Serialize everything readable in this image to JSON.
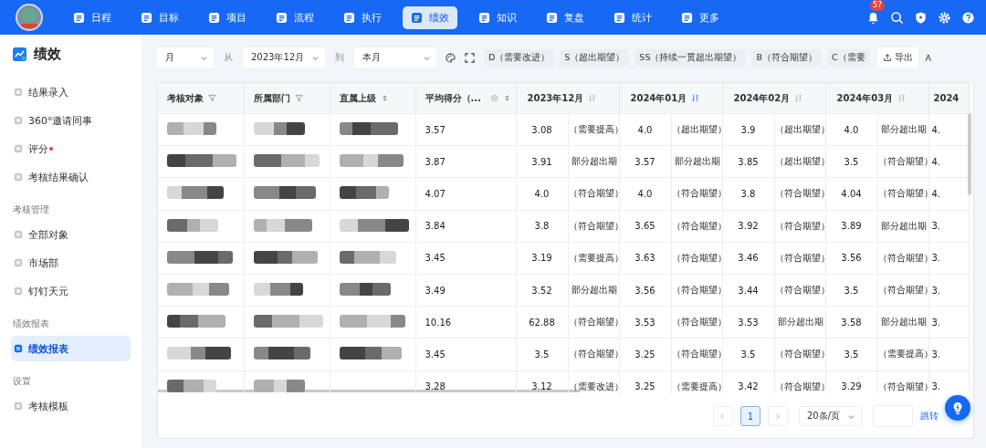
{
  "top_nav": {
    "items": [
      {
        "label": "日程",
        "selected": false
      },
      {
        "label": "目标",
        "selected": false
      },
      {
        "label": "项目",
        "selected": false
      },
      {
        "label": "流程",
        "selected": false
      },
      {
        "label": "执行",
        "selected": false
      },
      {
        "label": "绩效",
        "selected": true
      },
      {
        "label": "知识",
        "selected": false
      },
      {
        "label": "复盘",
        "selected": false
      },
      {
        "label": "统计",
        "selected": false
      },
      {
        "label": "更多",
        "selected": false
      }
    ],
    "notifications": "57"
  },
  "sidebar": {
    "title": "绩效",
    "sections": [
      {
        "items": [
          {
            "label": "结果录入",
            "selected": false,
            "dot": false
          },
          {
            "label": "360°邀请同事",
            "selected": false,
            "dot": false
          },
          {
            "label": "评分",
            "selected": false,
            "dot": true
          },
          {
            "label": "考核结果确认",
            "selected": false,
            "dot": false
          }
        ]
      },
      {
        "heading": "考核管理",
        "items": [
          {
            "label": "全部对象",
            "selected": false,
            "dot": false
          },
          {
            "label": "市场部",
            "selected": false,
            "dot": false
          },
          {
            "label": "钉钉天元",
            "selected": false,
            "dot": false
          }
        ]
      },
      {
        "heading": "绩效报表",
        "items": [
          {
            "label": "绩效报表",
            "selected": true,
            "dot": false
          }
        ]
      },
      {
        "heading": "设置",
        "items": [
          {
            "label": "考核模板",
            "selected": false,
            "dot": false
          }
        ]
      }
    ]
  },
  "toolbar": {
    "period": "月",
    "from_label": "从",
    "from": "2023年12月",
    "to_label": "到",
    "to": "本月",
    "grade_tags": [
      "D（需要改进）",
      "S（超出期望）",
      "SS（持续一贯超出期望）",
      "B（符合期望）",
      "C（需要"
    ],
    "export": "导出",
    "last_tag": "A"
  },
  "table": {
    "columns": [
      {
        "label": "考核对象",
        "kind": "filter"
      },
      {
        "label": "所属部门",
        "kind": "filter"
      },
      {
        "label": "直属上级",
        "kind": "sort"
      },
      {
        "label": "平均得分（...",
        "kind": "setting"
      }
    ],
    "months": [
      {
        "label": "2023年12月",
        "sorted": false
      },
      {
        "label": "2024年01月",
        "sorted": true
      },
      {
        "label": "2024年02月",
        "sorted": false
      },
      {
        "label": "2024年03月",
        "sorted": false
      }
    ],
    "last_column": "2024",
    "rows": [
      {
        "masked": [
          true,
          true,
          true
        ],
        "average": "3.57",
        "months": [
          {
            "score": "3.08",
            "grade": "（需要提高）"
          },
          {
            "score": "4.0",
            "grade": "（超出期望）"
          },
          {
            "score": "3.9",
            "grade": "（超出期望）"
          },
          {
            "score": "4.0",
            "grade": "部分超出期"
          }
        ],
        "last": "4."
      },
      {
        "masked": [
          true,
          true,
          true
        ],
        "average": "3.87",
        "months": [
          {
            "score": "3.91",
            "grade": "部分超出期"
          },
          {
            "score": "3.57",
            "grade": "部分超出期"
          },
          {
            "score": "3.85",
            "grade": "（超出期望）"
          },
          {
            "score": "3.5",
            "grade": "（符合期望）"
          }
        ],
        "last": "4."
      },
      {
        "masked": [
          true,
          true,
          true
        ],
        "average": "4.07",
        "months": [
          {
            "score": "4.0",
            "grade": "（符合期望）"
          },
          {
            "score": "4.0",
            "grade": "（符合期望）"
          },
          {
            "score": "3.8",
            "grade": "（符合期望）"
          },
          {
            "score": "4.04",
            "grade": "（符合期望）"
          }
        ],
        "last": "4."
      },
      {
        "masked": [
          true,
          true,
          true
        ],
        "average": "3.84",
        "months": [
          {
            "score": "3.8",
            "grade": "（符合期望）"
          },
          {
            "score": "3.65",
            "grade": "（符合期望）"
          },
          {
            "score": "3.92",
            "grade": "（符合期望）"
          },
          {
            "score": "3.89",
            "grade": "部分超出期"
          }
        ],
        "last": "3."
      },
      {
        "masked": [
          true,
          true,
          true
        ],
        "average": "3.45",
        "months": [
          {
            "score": "3.19",
            "grade": "（需要提高）"
          },
          {
            "score": "3.63",
            "grade": "（符合期望）"
          },
          {
            "score": "3.46",
            "grade": "（符合期望）"
          },
          {
            "score": "3.56",
            "grade": "（符合期望）"
          }
        ],
        "last": "3."
      },
      {
        "masked": [
          true,
          true,
          true
        ],
        "average": "3.49",
        "months": [
          {
            "score": "3.52",
            "grade": "部分超出期"
          },
          {
            "score": "3.56",
            "grade": "（符合期望）"
          },
          {
            "score": "3.44",
            "grade": "（符合期望）"
          },
          {
            "score": "3.5",
            "grade": "（符合期望）"
          }
        ],
        "last": "3."
      },
      {
        "masked": [
          true,
          true,
          true
        ],
        "average": "10.16",
        "months": [
          {
            "score": "62.88",
            "grade": "（符合期望）"
          },
          {
            "score": "3.53",
            "grade": "（符合期望）"
          },
          {
            "score": "3.53",
            "grade": "部分超出期"
          },
          {
            "score": "3.58",
            "grade": "部分超出期"
          }
        ],
        "last": "3."
      },
      {
        "masked": [
          true,
          true,
          true
        ],
        "average": "3.45",
        "months": [
          {
            "score": "3.5",
            "grade": "（符合期望）"
          },
          {
            "score": "3.25",
            "grade": "（符合期望）"
          },
          {
            "score": "3.5",
            "grade": "（符合期望）"
          },
          {
            "score": "3.5",
            "grade": "（需要提高）"
          }
        ],
        "last": "3."
      },
      {
        "masked": [
          true,
          true,
          false
        ],
        "average": "3.28",
        "months": [
          {
            "score": "3.12",
            "grade": "（需要改进）"
          },
          {
            "score": "3.25",
            "grade": "（需要提高）"
          },
          {
            "score": "3.42",
            "grade": "（符合期望）"
          },
          {
            "score": "3.29",
            "grade": "（符合期望）"
          }
        ],
        "last": "3."
      }
    ]
  },
  "pagination": {
    "pages": [
      {
        "label": "1",
        "selected": true
      }
    ],
    "page_size": "20条/页",
    "jump": "跳转"
  }
}
